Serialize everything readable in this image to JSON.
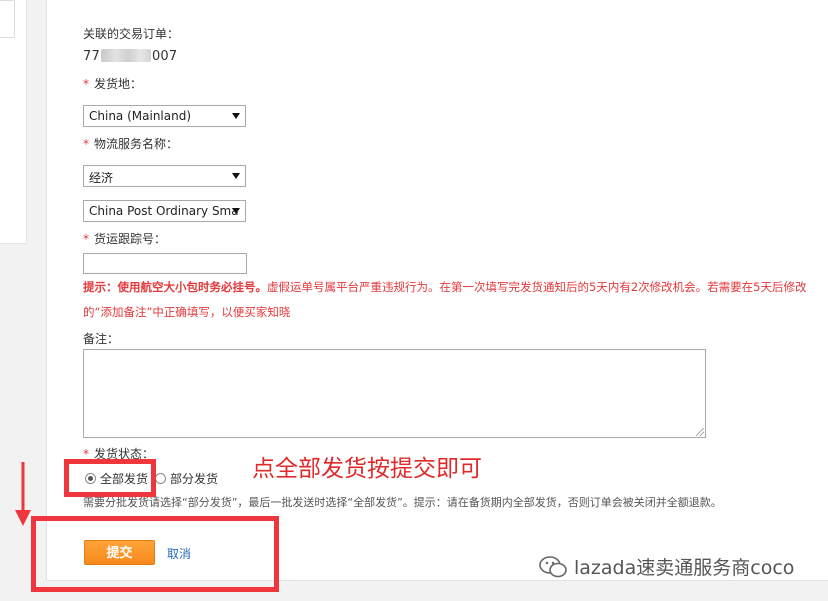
{
  "related_order": {
    "label": "关联的交易订单：",
    "value_prefix": "77",
    "value_suffix": "007"
  },
  "ship_from": {
    "required_mark": "*",
    "label": "发货地：",
    "selected": "China (Mainland)"
  },
  "logistics_service": {
    "required_mark": "*",
    "label": "物流服务名称：",
    "category_selected": "经济",
    "service_selected": "China Post Ordinary Sma"
  },
  "tracking_number": {
    "required_mark": "*",
    "label": "货运跟踪号：",
    "value": ""
  },
  "warning": {
    "bold_part": "提示：使用航空大小包时务必挂号。",
    "text_line1": "虚假运单号属平台严重违规行为。在第一次填写完发货通知后的5天内有2次修改机会。若需要在5天后修改",
    "text_line2": "的“添加备注”中正确填写，以便买家知晓"
  },
  "remarks": {
    "label": "备注：",
    "value": ""
  },
  "shipping_status": {
    "required_mark": "*",
    "label": "发货状态：",
    "options": [
      {
        "label": "全部发货",
        "checked": true
      },
      {
        "label": "部分发货",
        "checked": false
      }
    ],
    "hint": "需要分批发货请选择“部分发货”，最后一批发送时选择“全部发货”。提示：请在备货期内全部发货，否则订单会被关闭并全额退款。"
  },
  "actions": {
    "submit_label": "提交",
    "cancel_label": "取消"
  },
  "annotation": {
    "text": "点全部发货按提交即可",
    "color": "#e02a2a"
  },
  "watermark": {
    "text": "lazada速卖通服务商coco"
  },
  "colors": {
    "required": "#e4393c",
    "submit": "#f7891b",
    "link": "#2a6ab8",
    "annotation_box": "#f0363d"
  }
}
